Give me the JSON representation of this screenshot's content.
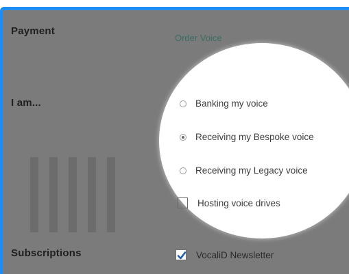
{
  "form": {
    "payment_label": "Payment",
    "order_voice_link": "Order Voice",
    "i_am_label": "I am...",
    "subscriptions_label": "Subscriptions"
  },
  "options": {
    "banking": "Banking my voice",
    "bespoke": "Receiving my Bespoke voice",
    "legacy": "Receiving my Legacy voice",
    "hosting": "Hosting voice drives",
    "selected": "bespoke"
  },
  "subscriptions": {
    "newsletter_label": "VocaliD Newsletter",
    "newsletter_checked": true
  },
  "colors": {
    "frame_border": "#1e8cf5",
    "overlay": "#7b7b7b",
    "link": "#3a6e63",
    "checkbox_accent": "#1e5fa8"
  }
}
